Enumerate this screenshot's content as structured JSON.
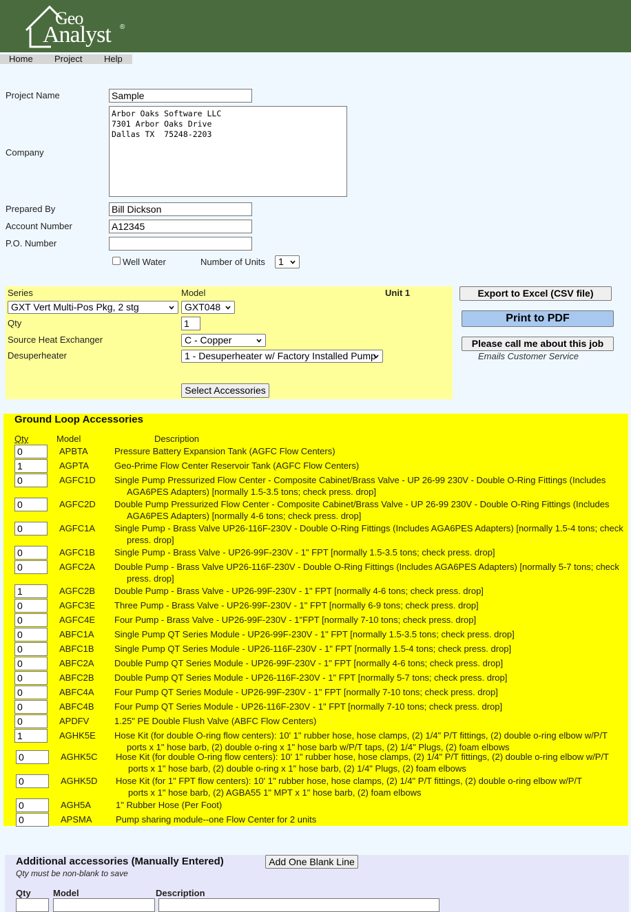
{
  "brand": {
    "logo_top": "Geo",
    "logo_bottom": "Analyst",
    "reg": "®",
    "header_color": "#4a6b3d"
  },
  "menu": [
    {
      "label": "Home"
    },
    {
      "label": "Project"
    },
    {
      "label": "Help"
    }
  ],
  "project": {
    "name_label": "Project Name",
    "name_value": "Sample",
    "company_label": "Company",
    "company_value": "Arbor Oaks Software LLC\n7301 Arbor Oaks Drive\nDallas TX  75248-2203",
    "prepared_label": "Prepared By",
    "prepared_value": "Bill Dickson",
    "account_label": "Account Number",
    "account_value": "A12345",
    "po_label": "P.O. Number",
    "po_value": "",
    "well_water_label": "Well Water",
    "units_label": "Number of Units",
    "units_value": "1"
  },
  "unit": {
    "series_label": "Series",
    "series_value": "GXT Vert Multi-Pos Pkg, 2 stg",
    "model_label": "Model",
    "model_value": "GXT048",
    "unit_title": "Unit 1",
    "qty_label": "Qty",
    "qty_value": "1",
    "source_label": "Source Heat Exchanger",
    "source_value": "C - Copper",
    "desup_label": "Desuperheater",
    "desup_value": "1 - Desuperheater w/ Factory Installed Pump",
    "select_acc_label": "Select Accessories"
  },
  "actions": {
    "export_label": "Export to Excel (CSV file)",
    "pdf_label": "Print to PDF",
    "call_label": "Please call me about this job",
    "call_note": "Emails Customer Service"
  },
  "ground": {
    "title": "Ground Loop Accessories",
    "col_qty": "Qty",
    "col_model": "Model",
    "col_desc": "Description",
    "items": [
      {
        "qty": "0",
        "model": "APBTA",
        "desc": "Pressure Battery Expansion Tank (AGFC Flow Centers)"
      },
      {
        "qty": "1",
        "model": "AGPTA",
        "desc": "Geo-Prime Flow Center Reservoir Tank (AGFC Flow Centers)"
      },
      {
        "qty": "0",
        "model": "AGFC1D",
        "desc": "Single Pump Pressurized Flow Center - Composite Cabinet/Brass Valve - UP 26-99 230V - Double O-Ring Fittings (Includes AGA6PES Adapters) [normally 1.5-3.5 tons; check press. drop]"
      },
      {
        "qty": "0",
        "model": "AGFC2D",
        "desc": "Double Pump Pressurized Flow Center - Composite Cabinet/Brass Valve - UP 26-99 230V - Double O-Ring Fittings (Includes AGA6PES Adapters) [normally 4-6 tons; check press. drop]"
      },
      {
        "qty": "0",
        "model": "AGFC1A",
        "desc": "Single Pump - Brass Valve UP26-116F-230V - Double O-Ring Fittings (Includes AGA6PES Adapters) [normally 1.5-4 tons; check press. drop]"
      },
      {
        "qty": "0",
        "model": "AGFC1B",
        "desc": "Single Pump - Brass Valve - UP26-99F-230V - 1\" FPT [normally 1.5-3.5 tons; check press. drop]"
      },
      {
        "qty": "0",
        "model": "AGFC2A",
        "desc": "Double Pump - Brass Valve UP26-116F-230V - Double O-Ring Fittings (Includes AGA6PES Adapters) [normally 5-7 tons; check press. drop]"
      },
      {
        "qty": "1",
        "model": "AGFC2B",
        "desc": "Double Pump - Brass Valve - UP26-99F-230V - 1\" FPT [normally 4-6 tons; check press. drop]"
      },
      {
        "qty": "0",
        "model": "AGFC3E",
        "desc": "Three Pump - Brass Valve - UP26-99F-230V - 1\" FPT [normally 6-9 tons; check press. drop]"
      },
      {
        "qty": "0",
        "model": "AGFC4E",
        "desc": "Four Pump - Brass Valve - UP26-99F-230V - 1\"FPT [normally 7-10 tons; check press. drop]"
      },
      {
        "qty": "0",
        "model": "ABFC1A",
        "desc": "Single Pump QT Series Module - UP26-99F-230V - 1\" FPT [normally 1.5-3.5 tons; check press. drop]"
      },
      {
        "qty": "0",
        "model": "ABFC1B",
        "desc": "Single Pump QT Series Module - UP26-116F-230V - 1\" FPT [normally 1.5-4 tons; check press. drop]"
      },
      {
        "qty": "0",
        "model": "ABFC2A",
        "desc": "Double Pump QT Series Module - UP26-99F-230V - 1\" FPT [normally 4-6 tons; check press. drop]"
      },
      {
        "qty": "0",
        "model": "ABFC2B",
        "desc": "Double Pump QT Series Module - UP26-116F-230V - 1\" FPT [normally 5-7 tons; check press. drop]"
      },
      {
        "qty": "0",
        "model": "ABFC4A",
        "desc": "Four Pump QT Series Module - UP26-99F-230V - 1\" FPT [normally 7-10 tons; check press. drop]"
      },
      {
        "qty": "0",
        "model": "ABFC4B",
        "desc": "Four Pump QT Series Module - UP26-116F-230V - 1\" FPT [normally 7-10 tons; check press. drop]"
      },
      {
        "qty": "0",
        "model": "APDFV",
        "desc": "1.25\" PE Double Flush Valve (ABFC Flow Centers)"
      },
      {
        "qty": "1",
        "model": "AGHK5E",
        "desc": "Hose Kit (for double O-ring flow centers): 10' 1\" rubber hose, hose clamps, (2) 1/4\" P/T fittings, (2) double o-ring elbow w/P/T ports x 1\" hose barb, (2) double o-ring x 1\" hose barb w/P/T taps, (2) 1/4\" Plugs, (2) foam elbows"
      },
      {
        "qty": "0",
        "model": "AGHK5C",
        "desc": "Hose Kit (for double O-ring flow centers): 10' 1\" rubber hose, hose clamps, (2) 1/4\" P/T fittings, (2) double o-ring elbow w/P/T ports x 1\" hose barb, (2) double o-ring x 1\" hose barb, (2) 1/4\" Plugs, (2) foam elbows"
      },
      {
        "qty": "0",
        "model": "AGHK5D",
        "desc": "Hose Kit (for 1\" FPT flow centers): 10' 1\" rubber hose, hose clamps, (2) 1/4\" P/T fittings, (2) double o-ring elbow w/P/T ports x 1\" hose barb, (2) AGBA55 1\" MPT x 1\" hose barb, (2) foam elbows"
      },
      {
        "qty": "0",
        "model": "AGH5A",
        "desc": "1\" Rubber Hose (Per Foot)"
      },
      {
        "qty": "0",
        "model": "APSMA",
        "desc": "Pump sharing module--one Flow Center for 2 units"
      }
    ]
  },
  "additional": {
    "title": "Additional accessories (Manually Entered)",
    "note": "Qty must be non-blank to save",
    "add_line_label": "Add One Blank Line",
    "col_qty": "Qty",
    "col_model": "Model",
    "col_desc": "Description",
    "row": {
      "qty": "",
      "model": "",
      "desc": ""
    }
  }
}
